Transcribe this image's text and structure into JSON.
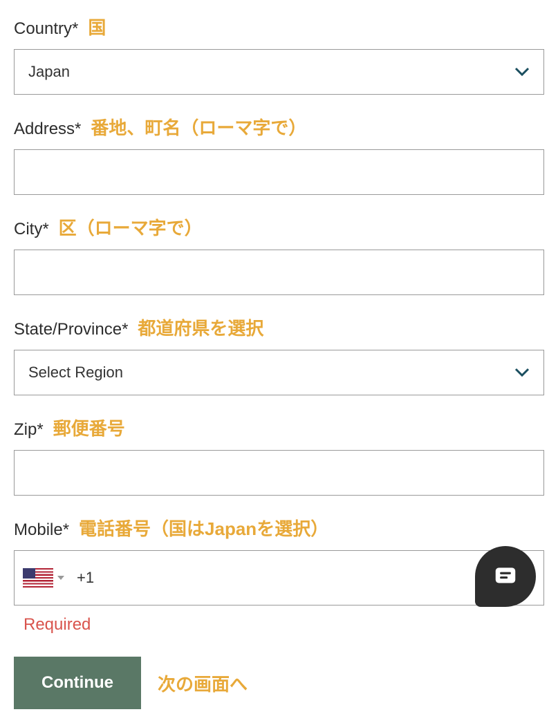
{
  "fields": {
    "country": {
      "label": "Country*",
      "hint": "国",
      "value": "Japan"
    },
    "address": {
      "label": "Address*",
      "hint": "番地、町名（ローマ字で）",
      "value": ""
    },
    "city": {
      "label": "City*",
      "hint": "区（ローマ字で）",
      "value": ""
    },
    "state": {
      "label": "State/Province*",
      "hint": "都道府県を選択",
      "value": "Select Region"
    },
    "zip": {
      "label": "Zip*",
      "hint": "郵便番号",
      "value": ""
    },
    "mobile": {
      "label": "Mobile*",
      "hint": "電話番号（国はJapanを選択）",
      "dial_code": "+1",
      "flag": "us",
      "error": "Required"
    }
  },
  "actions": {
    "continue_label": "Continue",
    "continue_hint": "次の画面へ"
  },
  "icons": {
    "chat": "chat-icon"
  }
}
